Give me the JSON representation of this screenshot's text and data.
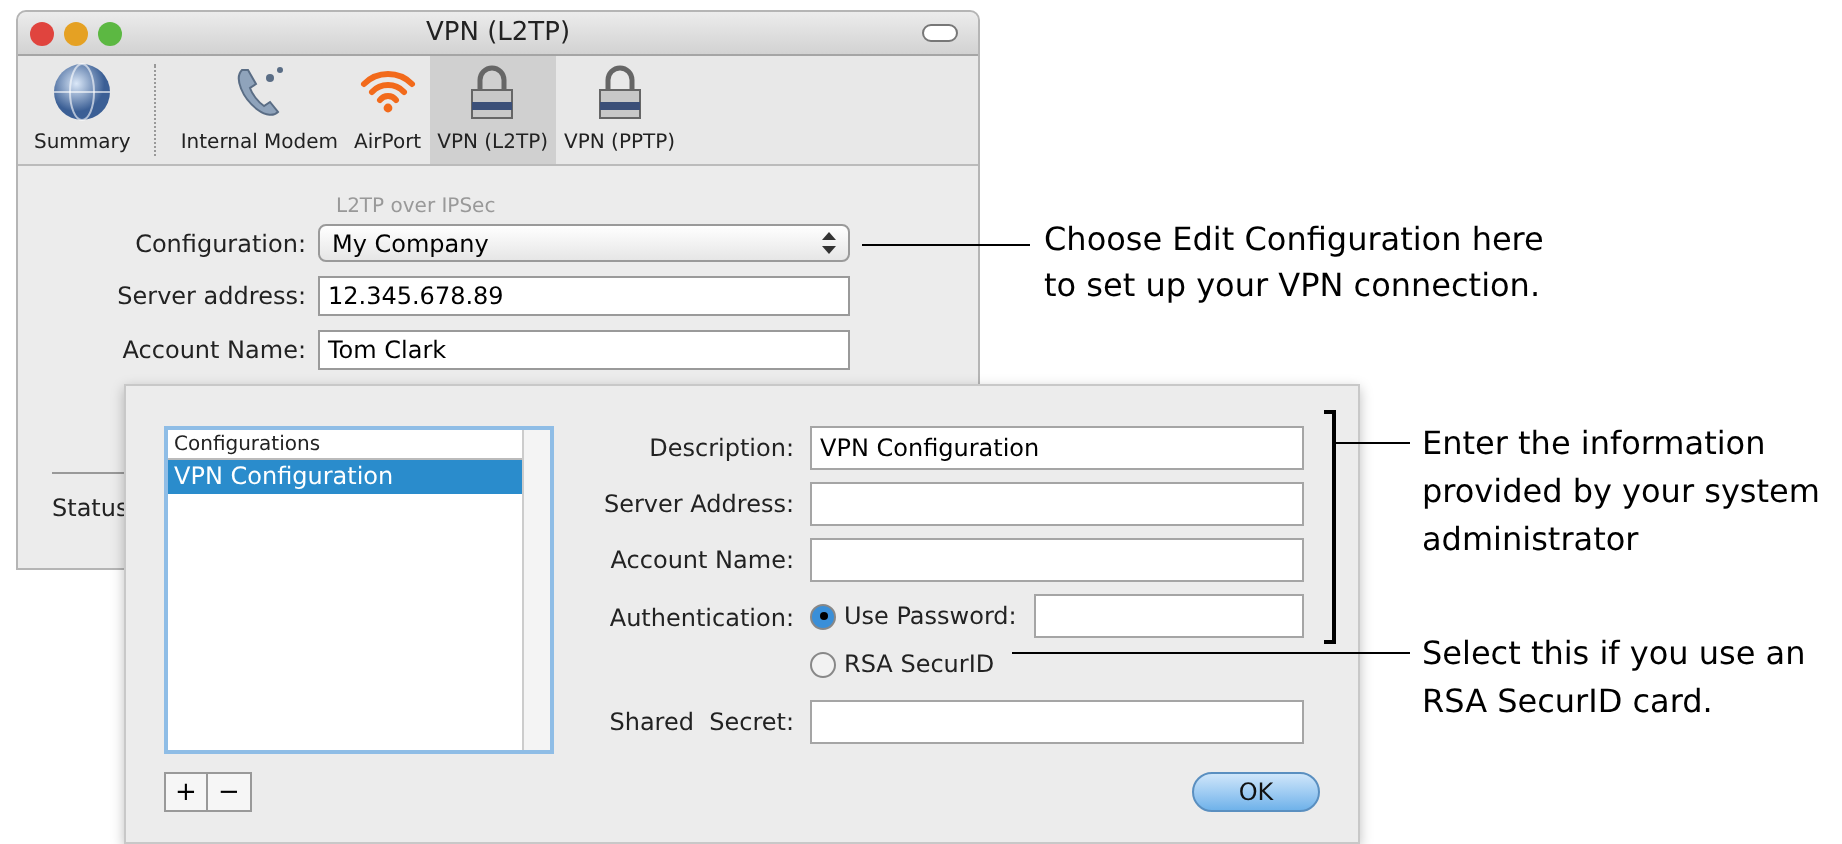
{
  "window": {
    "title": "VPN (L2TP)"
  },
  "toolbar": [
    {
      "label": "Summary",
      "kind": "globe",
      "selected": false
    },
    {
      "label": "Internal Modem",
      "kind": "phone",
      "selected": false
    },
    {
      "label": "AirPort",
      "kind": "wifi",
      "selected": false
    },
    {
      "label": "VPN (L2TP)",
      "kind": "lock",
      "selected": true
    },
    {
      "label": "VPN (PPTP)",
      "kind": "lock",
      "selected": false
    }
  ],
  "subtitle": "L2TP over IPSec",
  "form": [
    {
      "label": "Configuration:",
      "kind": "popup",
      "value": "My Company"
    },
    {
      "label": "Server address:",
      "kind": "text",
      "value": "12.345.678.89"
    },
    {
      "label": "Account Name:",
      "kind": "text",
      "value": "Tom Clark"
    }
  ],
  "status_label": "Status",
  "sheet": {
    "list": {
      "header": "Configurations",
      "items": [
        {
          "label": "VPN Configuration",
          "selected": true
        }
      ]
    },
    "add_button": "+",
    "remove_button": "−",
    "fields": [
      {
        "label": "Description:",
        "value": "VPN Configuration"
      },
      {
        "label": "Server Address:"
      },
      {
        "label": "Account Name:"
      }
    ],
    "authentication": {
      "label": "Authentication:",
      "options": [
        {
          "label": "Use Password:",
          "selected": true
        },
        {
          "label": "RSA SecurID",
          "selected": false
        }
      ]
    },
    "shared_secret": {
      "label": "Shared  Secret:"
    },
    "ok_button": "OK"
  },
  "callouts": [
    "Choose Edit Configuration here to set up your VPN connection.",
    "Enter the information provided by your system administrator",
    "Select this if you use an RSA SecurID card."
  ]
}
